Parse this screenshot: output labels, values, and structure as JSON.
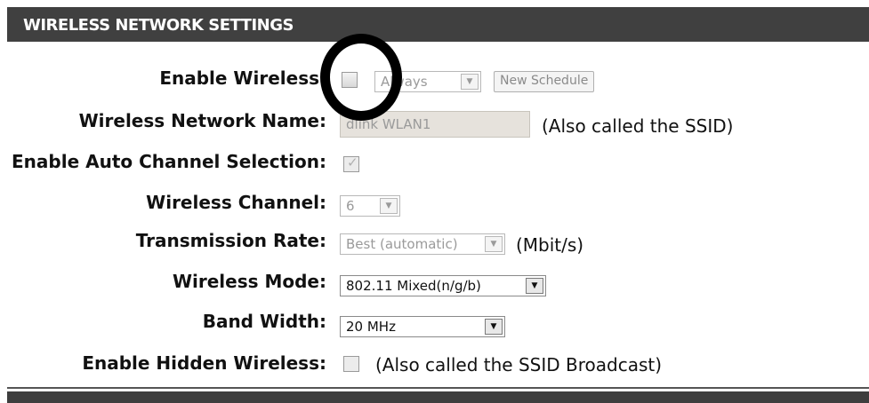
{
  "section": {
    "title": "WIRELESS NETWORK SETTINGS"
  },
  "enable_wireless": {
    "label": "Enable Wireless",
    "checked": false,
    "schedule_value": "Always",
    "new_schedule_label": "New Schedule"
  },
  "network_name": {
    "label": "Wireless Network Name",
    "value": "dlink WLAN1",
    "note": "(Also called the SSID)"
  },
  "auto_channel": {
    "label": "Enable Auto Channel Selection",
    "checked": true
  },
  "channel": {
    "label": "Wireless Channel",
    "value": "6"
  },
  "tx_rate": {
    "label": "Transmission Rate",
    "value": "Best (automatic)",
    "unit": "(Mbit/s)"
  },
  "mode": {
    "label": "Wireless Mode",
    "value": "802.11 Mixed(n/g/b)"
  },
  "band_width": {
    "label": "Band Width",
    "value": "20 MHz"
  },
  "hidden": {
    "label": "Enable Hidden Wireless",
    "checked": false,
    "note": "(Also called the SSID Broadcast)"
  },
  "colon": ":"
}
